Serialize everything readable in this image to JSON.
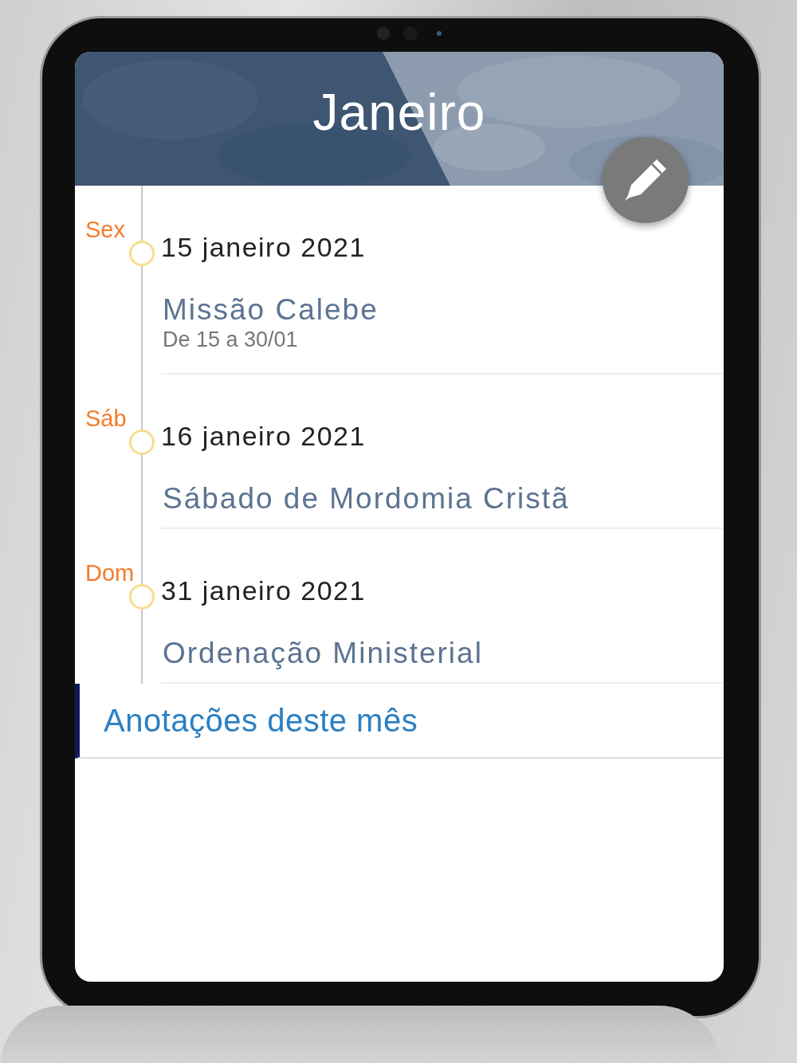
{
  "header": {
    "title": "Janeiro"
  },
  "events": [
    {
      "weekday": "Sex",
      "date": "15 janeiro 2021",
      "title": "Missão Calebe",
      "subtitle": "De 15 a 30/01"
    },
    {
      "weekday": "Sáb",
      "date": "16 janeiro 2021",
      "title": "Sábado de Mordomia Cristã"
    },
    {
      "weekday": "Dom",
      "date": "31 janeiro 2021",
      "title": "Ordenação Ministerial"
    }
  ],
  "notes": {
    "label": "Anotações deste mês"
  }
}
